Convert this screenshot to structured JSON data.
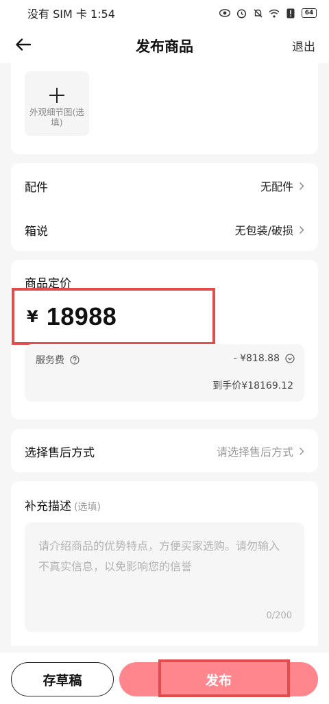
{
  "status_bar": {
    "carrier_time": "没有 SIM 卡 1:54",
    "icons": [
      "eye-icon",
      "alarm-icon",
      "mute-icon",
      "wifi-icon",
      "alert-icon",
      "battery-icon"
    ],
    "battery": "64"
  },
  "nav": {
    "title": "发布商品",
    "exit_label": "退出",
    "back_icon": "arrow-left-icon"
  },
  "photo": {
    "upload_label": "外观细节图(选填)"
  },
  "attributes": {
    "accessories_label": "配件",
    "accessories_value": "无配件",
    "box_label": "箱说",
    "box_value": "无包装/破损"
  },
  "pricing": {
    "title": "商品定价",
    "currency": "¥",
    "price": "18988",
    "service_fee_label": "服务费",
    "service_fee_value": "- ¥818.88",
    "net_price": "到手价¥18169.12"
  },
  "after_sale": {
    "label": "选择售后方式",
    "placeholder": "请选择售后方式"
  },
  "description": {
    "title": "补充描述",
    "optional": "(选填)",
    "placeholder": "请介绍商品的优势特点，方便买家选购。请勿输入不真实信息，以免影响您的信誉",
    "counter": "0/200"
  },
  "actions": {
    "draft_label": "存草稿",
    "publish_label": "发布"
  },
  "colors": {
    "accent": "#ff868c",
    "highlight": "#e24c4c"
  }
}
